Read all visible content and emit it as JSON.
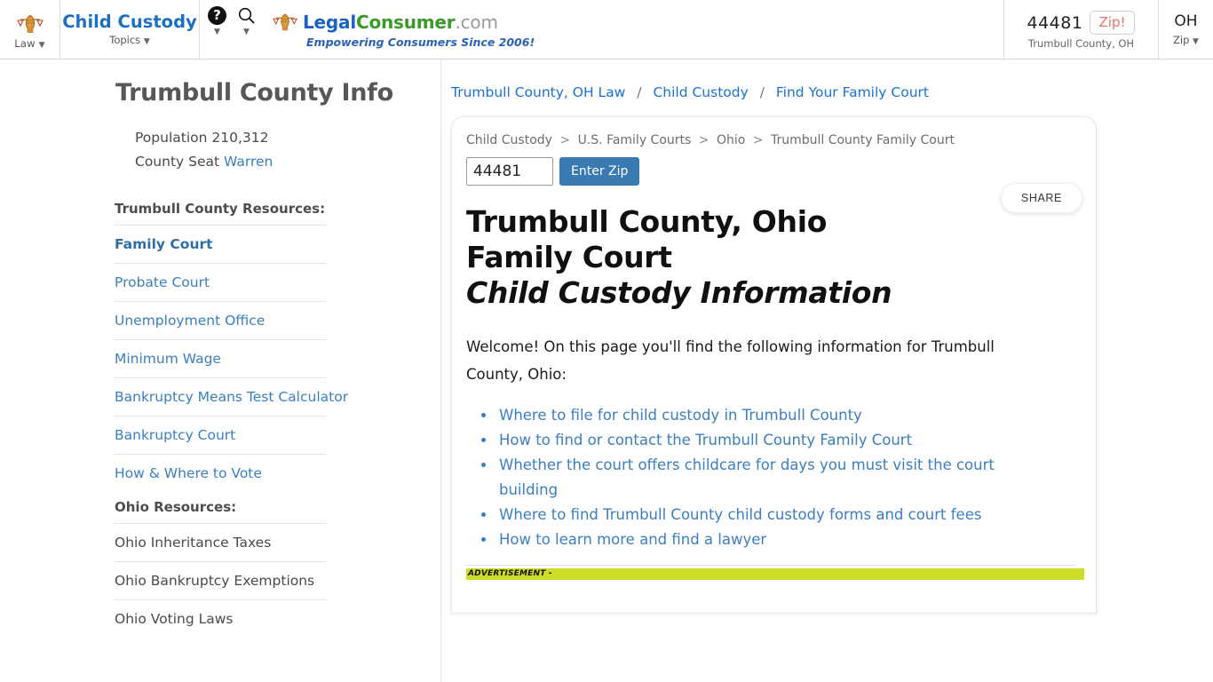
{
  "header": {
    "law_label": "Law",
    "law_icon": "scales-of-justice-icon",
    "topic_title": "Child Custody",
    "topic_sub": "Topics",
    "help_icon": "question-mark-icon",
    "search_icon": "search-icon",
    "brand": {
      "part1": "Legal",
      "part2": "Consumer",
      "part3": ".com",
      "tagline": "Empowering Consumers Since 2006!",
      "color_legal": "#1b62c4",
      "color_consumer": "#3a9b28",
      "color_com": "#9a9a9a"
    },
    "zip": {
      "value": "44481",
      "placeholder": "Zip",
      "button_label": "Zip!",
      "sub_label": "Trumbull County, OH",
      "button_color": "#e8726a"
    },
    "state": {
      "abbr": "OH",
      "sub_label": "Zip"
    },
    "caret_icon": "chevron-down-icon"
  },
  "sidebar": {
    "title": "Trumbull County Info",
    "stats": {
      "population_label": "Population",
      "population_value": "210,312",
      "county_seat_label": "County Seat",
      "county_seat_value": "Warren"
    },
    "groups": [
      {
        "heading": "Trumbull County Resources:",
        "items": [
          {
            "label": "Family Court",
            "active": true,
            "style": "link"
          },
          {
            "label": "Probate Court",
            "active": false,
            "style": "link"
          },
          {
            "label": "Unemployment Office",
            "active": false,
            "style": "link"
          },
          {
            "label": "Minimum Wage",
            "active": false,
            "style": "link"
          },
          {
            "label": "Bankruptcy Means Test Calculator",
            "active": false,
            "style": "link"
          },
          {
            "label": "Bankruptcy Court",
            "active": false,
            "style": "link"
          },
          {
            "label": "How & Where to Vote",
            "active": false,
            "style": "link"
          }
        ]
      },
      {
        "heading": "Ohio Resources:",
        "items": [
          {
            "label": "Ohio Inheritance Taxes",
            "active": false,
            "style": "plain"
          },
          {
            "label": "Ohio Bankruptcy Exemptions",
            "active": false,
            "style": "plain"
          },
          {
            "label": "Ohio Voting Laws",
            "active": false,
            "style": "plain"
          }
        ]
      }
    ]
  },
  "breadcrumbs": {
    "items": [
      "Trumbull County, OH Law",
      "Child Custody",
      "Find Your Family Court"
    ],
    "separator": "/"
  },
  "card": {
    "mini_breadcrumb": {
      "items": [
        "Child Custody",
        "U.S. Family Courts",
        "Ohio",
        "Trumbull County Family Court"
      ],
      "separator": ">"
    },
    "zip_form": {
      "value": "44481",
      "placeholder": "Zip code",
      "button_label": "Enter Zip"
    },
    "share_label": "SHARE",
    "title_line1": "Trumbull County, Ohio Family Court",
    "title_line2": "Child Custody Information",
    "welcome": "Welcome! On this page you'll find the following information for Trumbull County, Ohio:",
    "bullets": [
      "Where to file for child custody in Trumbull County",
      "How to find or contact the Trumbull County Family Court",
      "Whether the court offers childcare for days you must visit the court building",
      "Where to find Trumbull County child custody forms and court fees",
      "How to learn more and find a lawyer"
    ],
    "advertisement_label": "ADVERTISEMENT -",
    "advertisement_color": "#cddd28"
  }
}
